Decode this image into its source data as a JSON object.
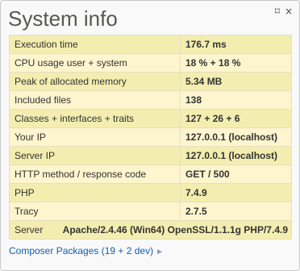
{
  "panel": {
    "title": "System info",
    "pin_icon_glyph": "⌑",
    "close_icon_glyph": "×"
  },
  "rows": [
    {
      "label": "Execution time",
      "value": "176.7 ms"
    },
    {
      "label": "CPU usage user + system",
      "value": "18 % + 18 %"
    },
    {
      "label": "Peak of allocated memory",
      "value": "5.34 MB"
    },
    {
      "label": "Included files",
      "value": "138"
    },
    {
      "label": "Classes + interfaces + traits",
      "value": "127 + 26 + 6"
    },
    {
      "label": "Your IP",
      "value": "127.0.0.1 (localhost)"
    },
    {
      "label": "Server IP",
      "value": "127.0.0.1 (localhost)"
    },
    {
      "label": "HTTP method / response code",
      "value": "GET / 500"
    },
    {
      "label": "PHP",
      "value": "7.4.9"
    },
    {
      "label": "Tracy",
      "value": "2.7.5"
    }
  ],
  "server": {
    "label": "Server",
    "value": "Apache/2.4.46 (Win64) OpenSSL/1.1.1g PHP/7.4.9"
  },
  "composer": {
    "label": "Composer Packages (19 + 2 dev)",
    "arrow": "►"
  }
}
